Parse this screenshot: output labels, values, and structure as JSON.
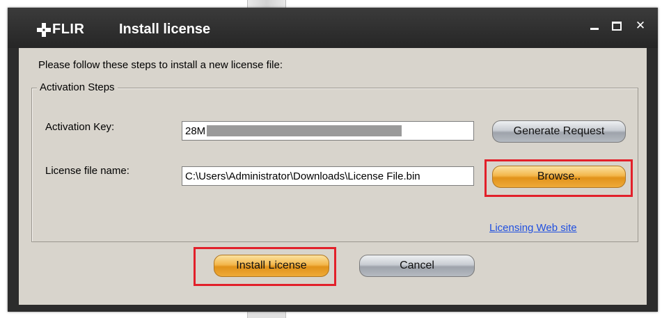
{
  "window": {
    "brand": "FLIR",
    "title": "Install license",
    "controls": [
      "minimize-icon",
      "maximize-icon",
      "close-icon"
    ]
  },
  "instructions": "Please follow these steps to install a new license file:",
  "activation": {
    "legend": "Activation Steps",
    "key_label": "Activation Key:",
    "key_value": "28M",
    "file_label": "License file name:",
    "file_value": "C:\\Users\\Administrator\\Downloads\\License File.bin",
    "generate_button": "Generate Request",
    "browse_button": "Browse..",
    "web_link": "Licensing Web site"
  },
  "footer": {
    "install_button": "Install License",
    "cancel_button": "Cancel"
  },
  "colors": {
    "highlight": "#e2202a",
    "primary_button": "#f0a830",
    "secondary_button": "#b5bac1",
    "link": "#1f4fe0"
  }
}
